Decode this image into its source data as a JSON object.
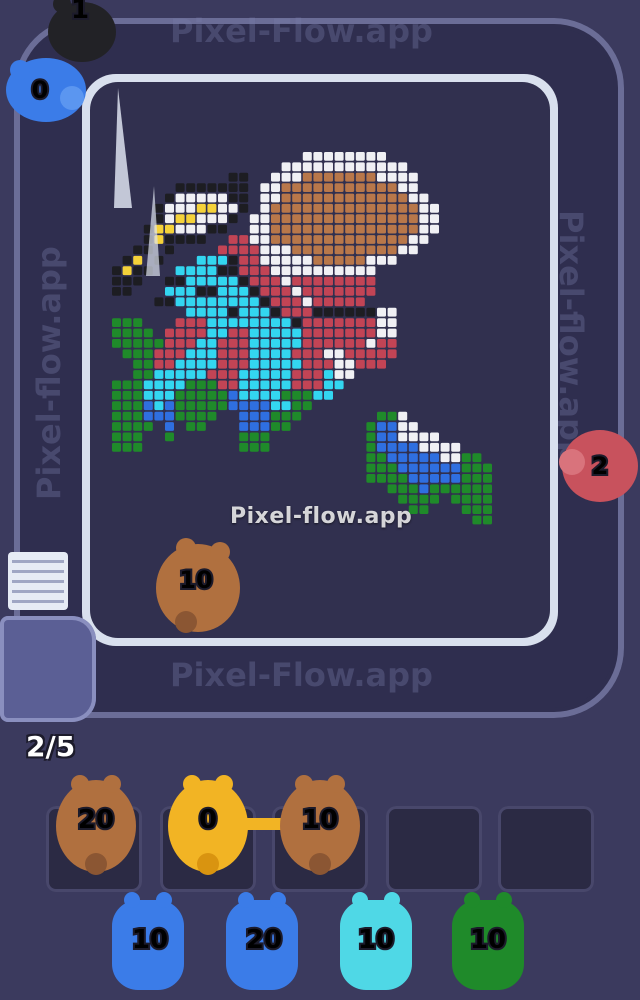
{
  "watermark": "Pixel-flow.app",
  "track_texts": [
    "Pixel-Flow.app",
    "Pixel-flow.app",
    "Pixel-flow.app",
    "Pixel-Flow.app"
  ],
  "progress": "2/5",
  "conveyor_pigs": [
    {
      "id": "black",
      "count": "1",
      "color": "#222226"
    },
    {
      "id": "blue",
      "count": "0",
      "color": "#3b7ce8"
    },
    {
      "id": "red",
      "count": "2",
      "color": "#c8525d"
    },
    {
      "id": "brown-floating",
      "count": "10",
      "color": "#b0703f"
    }
  ],
  "active_slots": [
    {
      "count": "20",
      "color": "#b0703f"
    },
    {
      "count": "0",
      "color": "#f2b424"
    },
    {
      "count": "10",
      "color": "#b0703f"
    },
    {
      "count": "",
      "color": ""
    },
    {
      "count": "",
      "color": ""
    }
  ],
  "queue": [
    {
      "count": "10",
      "color": "#3b7ce8"
    },
    {
      "count": "20",
      "color": "#3b7ce8"
    },
    {
      "count": "10",
      "color": "#4fd8e6"
    },
    {
      "count": "10",
      "color": "#1f8a2a"
    }
  ],
  "palette": {
    "K": "#1d1d22",
    "W": "#f0f0f4",
    "Y": "#f5d23a",
    "R": "#c24455",
    "B": "#33d6f0",
    "G": "#1f8a2a",
    "L": "#2f6fe0",
    "N": "#b8774a",
    "O": "#8b5633"
  }
}
